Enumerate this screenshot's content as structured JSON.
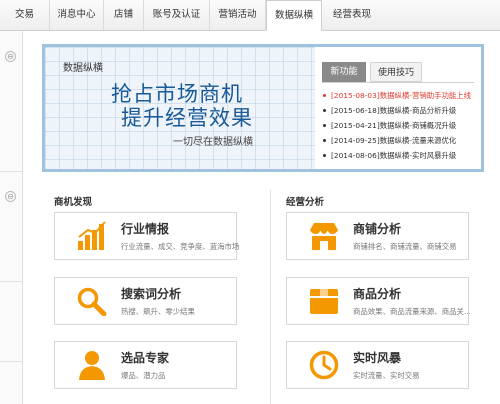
{
  "nav": {
    "tabs": [
      {
        "label": "交易"
      },
      {
        "label": "消息中心"
      },
      {
        "label": "店铺"
      },
      {
        "label": "账号及认证"
      },
      {
        "label": "营销活动"
      },
      {
        "label": "数据纵横"
      },
      {
        "label": "经营表现"
      }
    ],
    "active_tab": "数据纵横"
  },
  "sidebar": {
    "toggles": [
      "⊖",
      "⊖"
    ]
  },
  "banner": {
    "label": "数据纵横",
    "headline1": "抢占市场商机",
    "headline2": "提升经营效果",
    "subline": "一切尽在数据纵横",
    "tabs": [
      {
        "label": "新功能"
      },
      {
        "label": "使用技巧"
      }
    ],
    "news": [
      {
        "text": "[2015-08-03]数据纵横-营销助手功能上线",
        "highlight": true
      },
      {
        "text": "[2015-06-18]数据纵横-商品分析升级",
        "highlight": false
      },
      {
        "text": "[2015-04-21]数据纵横-商铺概况升级",
        "highlight": false
      },
      {
        "text": "[2014-09-25]数据纵横-流量来源优化",
        "highlight": false
      },
      {
        "text": "[2014-08-06]数据纵横-实时风暴升级",
        "highlight": false
      }
    ]
  },
  "sections": {
    "left": {
      "title": "商机发现",
      "cards": [
        {
          "title": "行业情报",
          "desc": "行业流量、成交、竞争度、蓝海市场",
          "icon": "bar-chart-icon"
        },
        {
          "title": "搜索词分析",
          "desc": "热搜、飙升、零少结果",
          "icon": "magnifier-icon"
        },
        {
          "title": "选品专家",
          "desc": "爆品、潜力品",
          "icon": "person-icon"
        }
      ]
    },
    "right": {
      "title": "经营分析",
      "cards": [
        {
          "title": "商铺分析",
          "desc": "商铺排名、商铺流量、商铺交易",
          "icon": "shop-icon"
        },
        {
          "title": "商品分析",
          "desc": "商品效果、商品流量来源、商品关...",
          "icon": "box-icon"
        },
        {
          "title": "实时风暴",
          "desc": "实时流量、实时交易",
          "icon": "clock-icon"
        }
      ]
    }
  },
  "colors": {
    "accent": "#f39800",
    "headline": "#1a5a96",
    "highlight": "#e03a2f",
    "banner_border": "#9fc3df"
  }
}
